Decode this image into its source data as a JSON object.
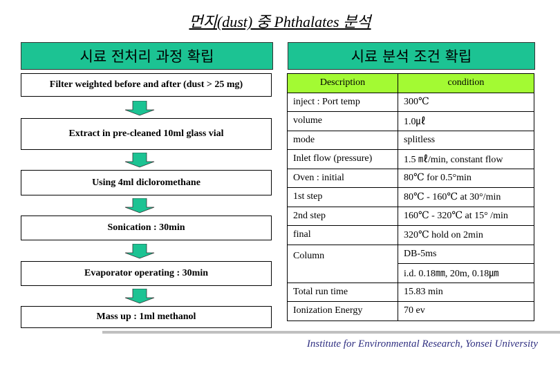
{
  "title": "먼지(dust) 중 Phthalates 분석",
  "left_section": {
    "heading": "시료 전처리 과정 확립",
    "steps": [
      "Filter weighted before and after (dust > 25 mg)",
      "Extract in pre-cleaned 10ml glass vial",
      "Using 4ml dicloromethane",
      "Sonication : 30min",
      "Evaporator operating : 30min",
      "Mass up : 1ml methanol"
    ]
  },
  "right_section": {
    "heading": "시료 분석 조건 확립",
    "table": {
      "headers": [
        "Description",
        "condition"
      ],
      "rows": [
        {
          "description": "inject : Port temp",
          "condition": "300℃"
        },
        {
          "description": "volume",
          "condition": "1.0㎕"
        },
        {
          "description": "mode",
          "condition": "splitless"
        },
        {
          "description": "Inlet flow (pressure)",
          "condition": "1.5 ㎖/min, constant flow"
        },
        {
          "description": "Oven : initial",
          "condition": "80℃  for 0.5°min"
        },
        {
          "description": "1st step",
          "condition": "80℃ - 160℃ at 30°/min"
        },
        {
          "description": "2nd step",
          "condition": "160℃ - 320℃  at 15° /min"
        },
        {
          "description": "final",
          "condition": "320℃ hold on 2min"
        },
        {
          "description": "Column",
          "condition": "DB-5ms",
          "condition_2": "i.d. 0.18㎜,  20m,  0.18㎛"
        },
        {
          "description": "Total run time",
          "condition": "15.83 min"
        },
        {
          "description": "Ionization Energy",
          "condition": "70 ev"
        }
      ]
    }
  },
  "colors": {
    "heading_green": "#1cc393",
    "table_header_lime": "#a3fa33",
    "footer_text": "#2e2e80"
  },
  "footer": "Institute for Environmental Research, Yonsei University"
}
